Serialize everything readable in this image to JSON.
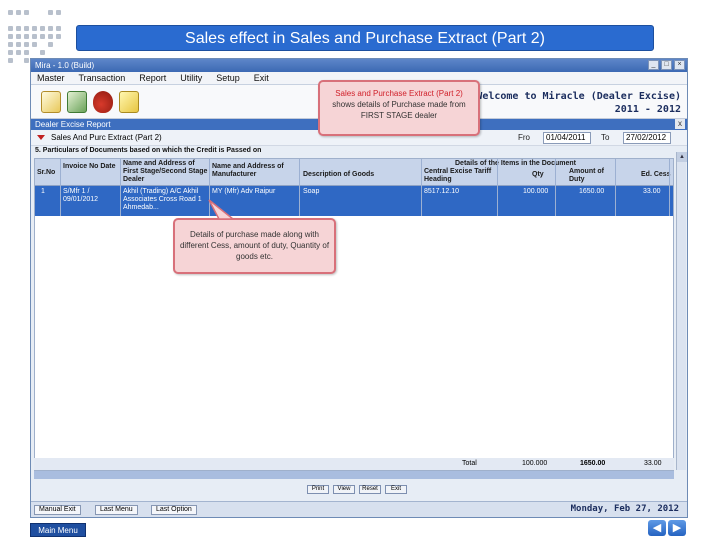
{
  "slide": {
    "title": "Sales effect in Sales and Purchase Extract (Part 2)",
    "main_menu_label": "Main Menu",
    "prev_label": "◀",
    "next_label": "▶"
  },
  "window": {
    "title": "Mira - 1.0 (Build)",
    "menu": [
      "Master",
      "Transaction",
      "Report",
      "Utility",
      "Setup",
      "Exit"
    ],
    "welcome_line1": "2 : Welcome to Miracle (Dealer Excise)",
    "welcome_line2": "2011 - 2012",
    "close_glyph": "x"
  },
  "toolbar": {
    "icons": [
      "documents-icon",
      "money-icon",
      "bag-icon",
      "notes-icon"
    ]
  },
  "dealer_bar": {
    "title": "Dealer Excise Report"
  },
  "report": {
    "name": "Sales And Purc Extract (Part 2)",
    "from_label": "Fro",
    "from_date": "01/04/2011",
    "to_label": "To",
    "to_date": "27/02/2012",
    "section_label": "5. Particulars of Documents based on which the Credit is Passed on"
  },
  "table": {
    "group_header": "Details of the Items in the Document",
    "headers": {
      "sr_no": "Sr.No",
      "invoice": "Invoice No Date",
      "first_stage": "Name and Address of First Stage/Second Stage Dealer",
      "manufacturer": "Name and Address of Manufacturer",
      "description": "Description of Goods",
      "tariff": "Central Excise Tariff Heading",
      "qty": "Qty",
      "duty": "Amount of Duty",
      "ed_cess": "Ed. Cess"
    },
    "rows": [
      {
        "sr_no": "1",
        "invoice": "S/Mfr 1 / 09/01/2012",
        "first_stage": "Akhil (Trading) A/C Akhil Associates Cross Road 1 Ahmedab...",
        "manufacturer": "MY (Mfr) Adv Raipur",
        "description": "Soap",
        "tariff": "8517.12.10",
        "qty": "100.000",
        "duty": "1650.00",
        "ed_cess": "33.00"
      }
    ],
    "totals": {
      "label": "Total",
      "qty": "100.000",
      "duty": "1650.00",
      "ed_cess": "33.00"
    }
  },
  "buttons": {
    "print": "Print",
    "view": "View",
    "reset": "Reset",
    "exit": "Exit"
  },
  "status_bar": {
    "buttons": [
      "Manual Exit",
      "Last Menu",
      "Last Option"
    ],
    "date": "Monday, Feb 27, 2012"
  },
  "callouts": {
    "top_title": "Sales and Purchase Extract (Part 2)",
    "top_body": "shows details of Purchase made from FIRST STAGE dealer",
    "mid_body": "Details of purchase made along with different Cess, amount of duty, Quantity of goods etc."
  },
  "colors": {
    "title_bar": "#2a6bd0",
    "selected_row": "#2f68c4",
    "callout_fill": "#f6d4d6",
    "callout_border": "#d8707a"
  }
}
